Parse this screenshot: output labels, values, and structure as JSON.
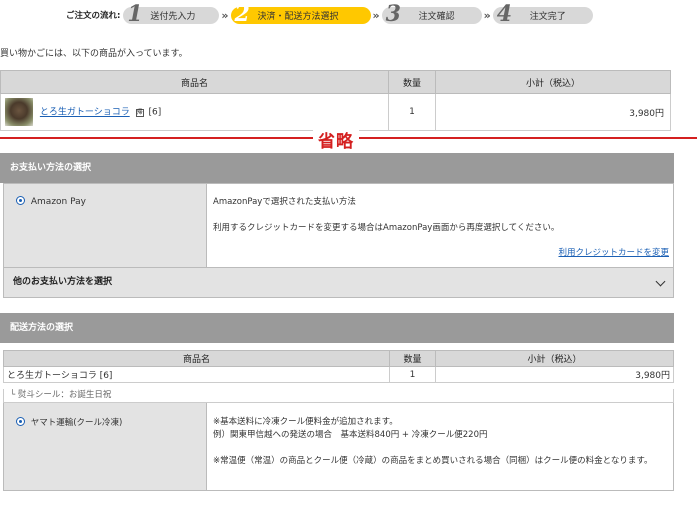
{
  "steps": {
    "flow_label": "ご注文の流れ:",
    "items": [
      {
        "num": "1",
        "label": "送付先入力"
      },
      {
        "num": "2",
        "label": "決済・配送方法選択"
      },
      {
        "num": "3",
        "label": "注文確認"
      },
      {
        "num": "4",
        "label": "注文完了"
      }
    ],
    "arrow": "»"
  },
  "intro_text": "買い物かごには、以下の商品が入っています。",
  "cart": {
    "headers": [
      "商品名",
      "数量",
      "小計（税込）"
    ],
    "row": {
      "name": "とろ生ガトーショコラ",
      "icon": "帰",
      "option": "[6]",
      "qty": "1",
      "subtotal": "3,980円"
    }
  },
  "omit_label": "省略",
  "payment": {
    "section_title": "お支払い方法の選択",
    "method": "Amazon Pay",
    "line1": "AmazonPayで選択された支払い方法",
    "line2": "利用するクレジットカードを変更する場合はAmazonPay画面から再度選択してください。",
    "change_link": "利用クレジットカードを変更",
    "other_label": "他のお支払い方法を選択"
  },
  "shipping": {
    "section_title": "配送方法の選択",
    "headers": [
      "商品名",
      "数量",
      "小計（税込）"
    ],
    "row": {
      "name": "とろ生ガトーショコラ [6]",
      "qty": "1",
      "subtotal": "3,980円"
    },
    "noshi": "└ 熨斗シール：お誕生日祝",
    "method": "ヤマト運輸(クール冷凍)",
    "note1": "※基本送料に冷凍クール便料金が追加されます。",
    "note2": "例）関東甲信越への発送の場合　基本送料840円 + 冷凍クール便220円",
    "note3": "※常温便（常温）の商品とクール便（冷蔵）の商品をまとめ買いされる場合（同梱）はクール便の料金となります。"
  }
}
